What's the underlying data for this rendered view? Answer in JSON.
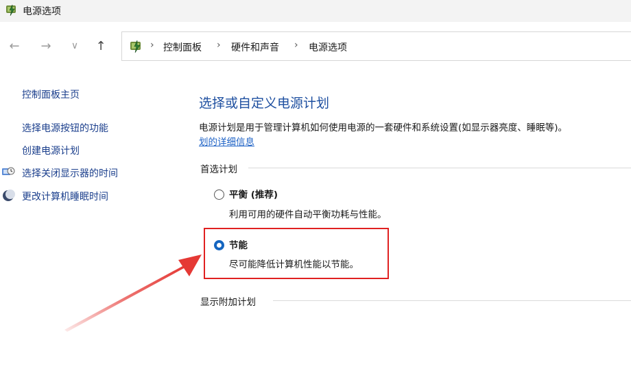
{
  "window": {
    "title": "电源选项"
  },
  "nav": {
    "back": "←",
    "forward": "→",
    "recent": "∨",
    "up": "↑"
  },
  "breadcrumb": [
    "控制面板",
    "硬件和声音",
    "电源选项"
  ],
  "breadcrumb_separator": "›",
  "sidebar": {
    "items": [
      {
        "label": "控制面板主页"
      },
      {
        "label": "选择电源按钮的功能"
      },
      {
        "label": "创建电源计划"
      },
      {
        "label": "选择关闭显示器的时间"
      },
      {
        "label": "更改计算机睡眠时间"
      }
    ]
  },
  "main": {
    "heading": "选择或自定义电源计划",
    "description": "电源计划是用于管理计算机如何使用电源的一套硬件和系统设置(如显示器亮度、睡眠等)。",
    "more_link": "划的详细信息",
    "preferred_group": "首选计划",
    "plans": [
      {
        "name": "平衡 (推荐)",
        "desc": "利用可用的硬件自动平衡功耗与性能。",
        "selected": false
      },
      {
        "name": "节能",
        "desc": "尽可能降低计算机性能以节能。",
        "selected": true
      }
    ],
    "additional_group": "显示附加计划"
  },
  "colors": {
    "link": "#1a3e8c",
    "heading": "#1e4fa0",
    "accent": "#1565c0",
    "highlight": "#e02020"
  }
}
